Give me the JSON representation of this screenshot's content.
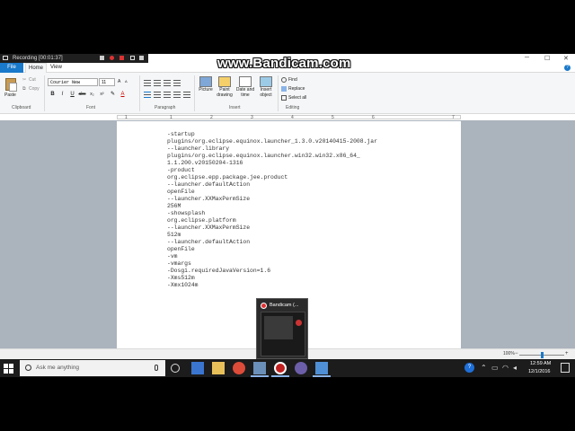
{
  "watermark": "www.Bandicam.com",
  "recording": {
    "label": "Recording [00:01:37]"
  },
  "tabs": {
    "file": "File",
    "home": "Home",
    "view": "View"
  },
  "clipboard": {
    "paste": "Paste",
    "cut": "Cut",
    "copy": "Copy",
    "group": "Clipboard"
  },
  "font": {
    "family": "Courier New",
    "size": "11",
    "group": "Font",
    "bold": "B",
    "italic": "I",
    "underline": "U",
    "strike": "abc",
    "sub": "x₂",
    "sup": "x²",
    "color": "A"
  },
  "paragraph": {
    "group": "Paragraph"
  },
  "insert": {
    "picture": "Picture",
    "paint_line1": "Paint",
    "paint_line2": "drawing",
    "datetime_line1": "Date and",
    "datetime_line2": "time",
    "object_line1": "Insert",
    "object_line2": "object",
    "group": "Insert"
  },
  "editing": {
    "find": "Find",
    "replace": "Replace",
    "select_all": "Select all",
    "group": "Editing"
  },
  "ruler": [
    "1",
    "1",
    "2",
    "3",
    "4",
    "5",
    "6",
    "7"
  ],
  "document": {
    "lines": [
      "-startup",
      "plugins/org.eclipse.equinox.launcher_1.3.0.v20140415-2008.jar",
      "--launcher.library",
      "plugins/org.eclipse.equinox.launcher.win32.win32.x86_64_",
      "1.1.200.v20150204-1316",
      "-product",
      "org.eclipse.epp.package.jee.product",
      "--launcher.defaultAction",
      "openFile",
      "--launcher.XXMaxPermSize",
      "256M",
      "-showsplash",
      "org.eclipse.platform",
      "--launcher.XXMaxPermSize",
      "512m",
      "--launcher.defaultAction",
      "openFile",
      "-vm",
      "-vmargs",
      "-Dosgi.requiredJavaVersion=1.6",
      "-Xms512m",
      "-Xmx1024m"
    ]
  },
  "status": {
    "zoom": "100%",
    "zoom_level": 1.0
  },
  "preview": {
    "title": "Bandicam (..."
  },
  "taskbar": {
    "search_placeholder": "Ask me anything",
    "time": "12:59 AM",
    "date": "12/1/2016"
  },
  "colors": {
    "accent": "#1979ca",
    "taskbar": "#1c1c1c",
    "ribbon": "#f5f6f7",
    "doc_bg": "#abb3bd"
  }
}
